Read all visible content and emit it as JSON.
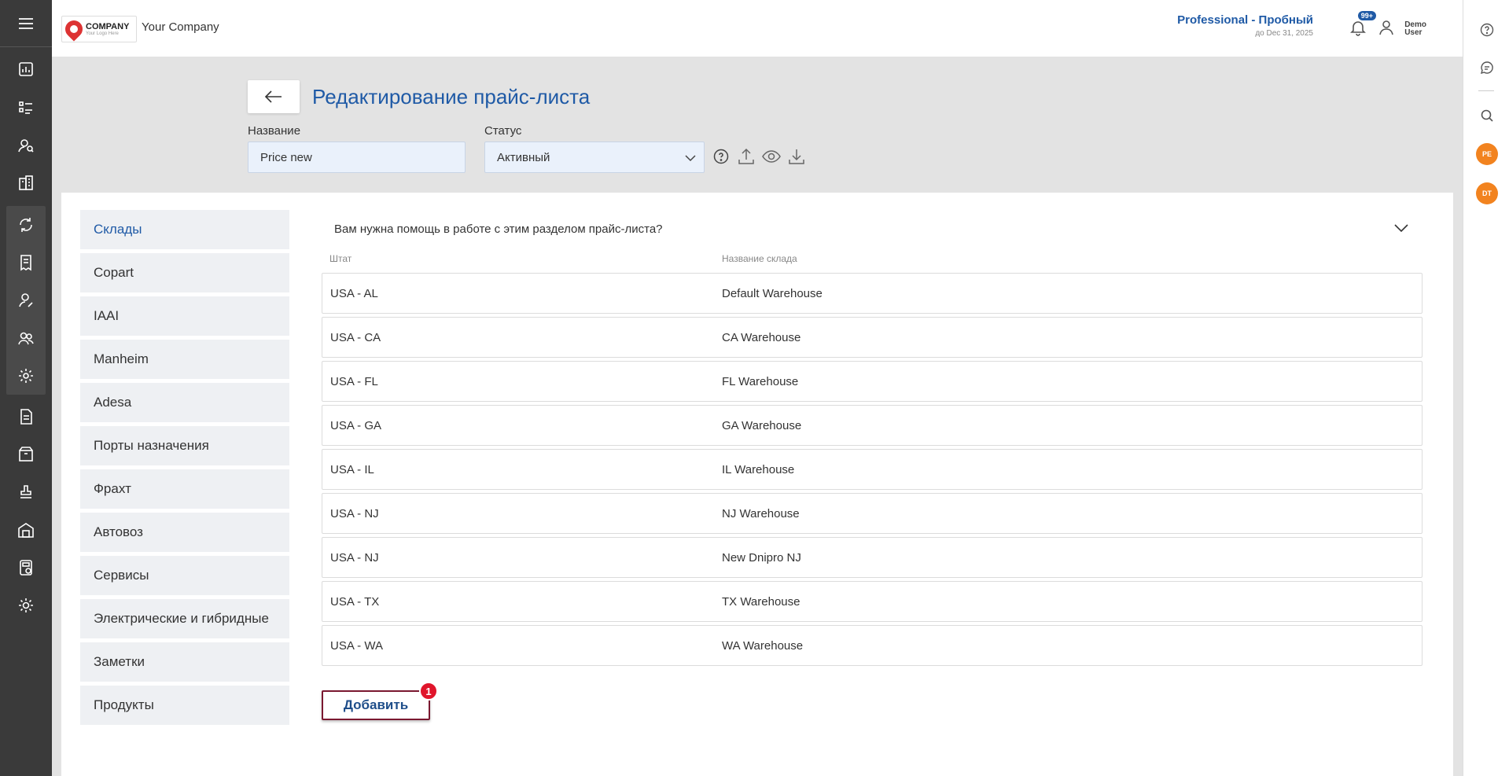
{
  "header": {
    "logo_text": "COMPANY",
    "logo_sub": "Your Logo Here",
    "company_name": "Your Company",
    "plan_name": "Professional - Пробный",
    "plan_until": "до Dec 31, 2025",
    "notifications_badge": "99+",
    "user_name_line1": "Demo",
    "user_name_line2": "User"
  },
  "sidebar": {
    "icons": [
      "menu-icon",
      "dashboard-icon",
      "checklist-icon",
      "users-search-icon",
      "buildings-icon",
      "exchange-icon",
      "receipt-icon",
      "user-edit-icon",
      "users-icon",
      "settings-user-icon",
      "document-icon",
      "box-icon",
      "stamp-icon",
      "warehouse-icon",
      "calculator-icon",
      "gear-icon"
    ]
  },
  "rightbar": {
    "avatar1": "PE",
    "avatar2": "DT"
  },
  "page": {
    "title": "Редактирование прайс-листа",
    "name_label": "Название",
    "name_value": "Price new",
    "status_label": "Статус",
    "status_value": "Активный"
  },
  "tabs": [
    {
      "label": "Склады",
      "active": true
    },
    {
      "label": "Copart"
    },
    {
      "label": "IAAI"
    },
    {
      "label": "Manheim"
    },
    {
      "label": "Adesa"
    },
    {
      "label": "Порты назначения"
    },
    {
      "label": "Фрахт"
    },
    {
      "label": "Автовоз"
    },
    {
      "label": "Сервисы"
    },
    {
      "label": "Электрические и гибридные"
    },
    {
      "label": "Заметки"
    },
    {
      "label": "Продукты"
    }
  ],
  "warehouses": {
    "help_text": "Вам нужна помощь в работе с этим разделом прайс-листа?",
    "col_state": "Штат",
    "col_name": "Название склада",
    "rows": [
      {
        "state": "USA - AL",
        "name": "Default Warehouse"
      },
      {
        "state": "USA - CA",
        "name": "CA Warehouse"
      },
      {
        "state": "USA - FL",
        "name": "FL Warehouse"
      },
      {
        "state": "USA - GA",
        "name": "GA Warehouse"
      },
      {
        "state": "USA - IL",
        "name": "IL Warehouse"
      },
      {
        "state": "USA - NJ",
        "name": "NJ Warehouse"
      },
      {
        "state": "USA - NJ",
        "name": "New Dnipro NJ"
      },
      {
        "state": "USA - TX",
        "name": "TX Warehouse"
      },
      {
        "state": "USA - WA",
        "name": "WA Warehouse"
      }
    ],
    "add_label": "Добавить",
    "add_badge": "1"
  },
  "colors": {
    "accent": "#1f5aa6",
    "sidebar": "#3a3a3a",
    "avatar": "#f2831f",
    "badge": "#e0152b"
  }
}
